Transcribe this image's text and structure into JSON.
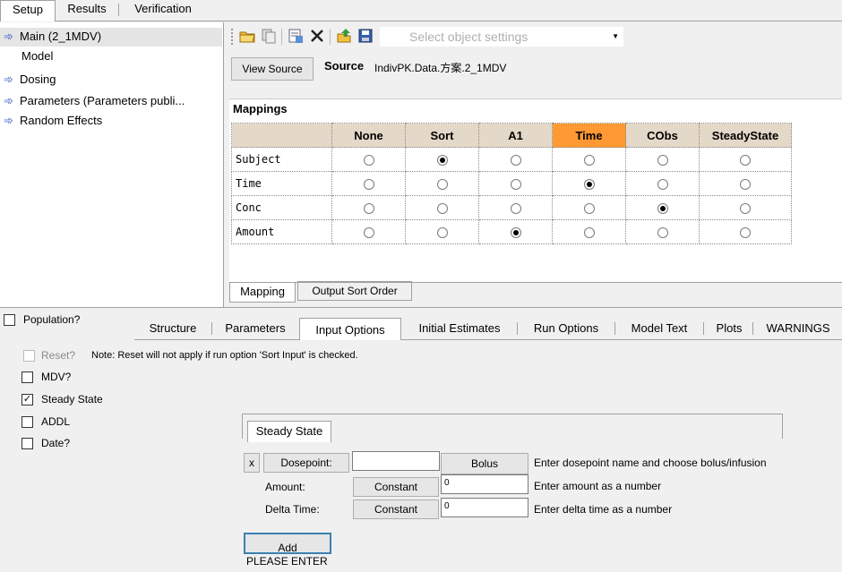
{
  "top_tabs": [
    "Setup",
    "Results",
    "Verification"
  ],
  "tree": {
    "items": [
      {
        "label": "Main (2_1MDV)",
        "icon": "arrow-icon"
      },
      {
        "label": "Model",
        "icon": ""
      },
      {
        "label": "Dosing",
        "icon": "arrow-icon"
      },
      {
        "label": "Parameters (Parameters publi...",
        "icon": "arrow-icon"
      },
      {
        "label": "Random Effects",
        "icon": "arrow-icon"
      }
    ]
  },
  "toolbar": {
    "select_placeholder": "Select object settings"
  },
  "source": {
    "button": "View Source",
    "label": "Source",
    "value": "IndivPK.Data.方案.2_1MDV"
  },
  "mappings": {
    "title": "Mappings",
    "columns": [
      "None",
      "Sort",
      "A1",
      "Time",
      "CObs",
      "SteadyState"
    ],
    "rows": [
      {
        "label": "Subject",
        "selected": 1
      },
      {
        "label": "Time",
        "selected": 3
      },
      {
        "label": "Conc",
        "selected": 4
      },
      {
        "label": "Amount",
        "selected": 2
      }
    ],
    "tabs": [
      "Mapping",
      "Output Sort Order"
    ]
  },
  "options": {
    "population_label": "Population?",
    "tabs": [
      "Structure",
      "Parameters",
      "Input Options",
      "Initial Estimates",
      "Run Options",
      "Model Text",
      "Plots",
      "WARNINGS"
    ],
    "active_tab": "Input Options",
    "reset_label": "Reset?",
    "reset_note": "Note: Reset will not apply if run option 'Sort Input' is checked.",
    "checkboxes": [
      {
        "label": "MDV?",
        "checked": false
      },
      {
        "label": "Steady State",
        "checked": true
      },
      {
        "label": "ADDL",
        "checked": false
      },
      {
        "label": "Date?",
        "checked": false
      }
    ]
  },
  "steady_state": {
    "tab": "Steady State",
    "x_button": "x",
    "dosepoint_button": "Dosepoint:",
    "dosepoint_value": "",
    "bolus_button": "Bolus",
    "dosepoint_hint": "Enter dosepoint name and choose bolus/infusion",
    "amount_label": "Amount:",
    "amount_button": "Constant",
    "amount_value": "0",
    "amount_hint": "Enter amount as a number",
    "delta_label": "Delta Time:",
    "delta_button": "Constant",
    "delta_value": "0",
    "delta_hint": "Enter delta time as a number",
    "add_button": "Add",
    "status": "PLEASE ENTER"
  },
  "colors": {
    "accent_time": "#ff9933",
    "header_bg": "#e4d8c8"
  }
}
